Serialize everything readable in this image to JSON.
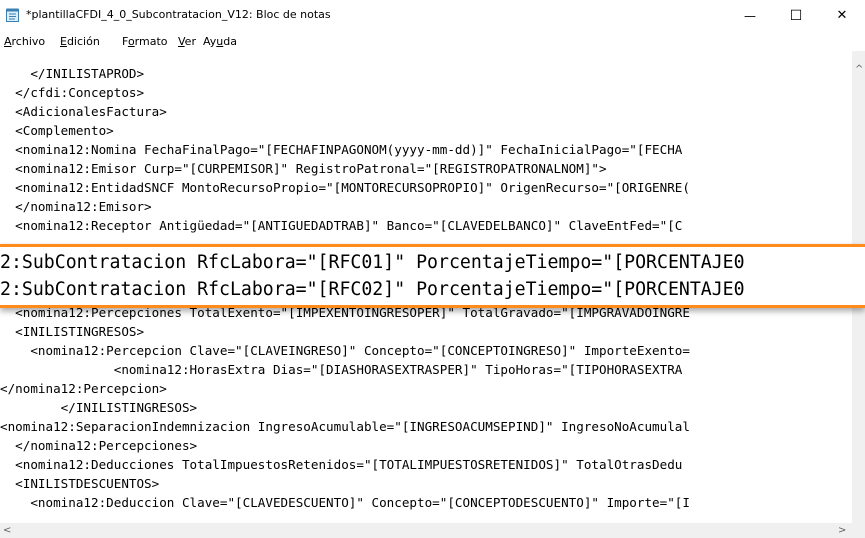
{
  "window": {
    "title": "*plantillaCFDI_4_0_Subcontratacion_V12: Bloc de notas",
    "minimize_glyph": "—",
    "maximize_glyph": "☐",
    "close_glyph": "✕"
  },
  "menu": {
    "items": [
      {
        "pre": "",
        "key": "A",
        "post": "rchivo"
      },
      {
        "pre": "",
        "key": "E",
        "post": "dición"
      },
      {
        "pre": "F",
        "key": "o",
        "post": "rmato"
      },
      {
        "pre": "",
        "key": "V",
        "post": "er"
      },
      {
        "pre": "Ay",
        "key": "u",
        "post": "da"
      }
    ]
  },
  "editor": {
    "lines_top": [
      "    </INILISTAPROD>",
      "  </cfdi:Conceptos>",
      "  <AdicionalesFactura>",
      "  <Complemento>",
      "  <nomina12:Nomina FechaFinalPago=\"[FECHAFINPAGONOM(yyyy-mm-dd)]\" FechaInicialPago=\"[FECHA",
      "  <nomina12:Emisor Curp=\"[CURPEMISOR]\" RegistroPatronal=\"[REGISTROPATRONALNOM]\">",
      "  <nomina12:EntidadSNCF MontoRecursoPropio=\"[MONTORECURSOPROPIO]\" OrigenRecurso=\"[ORIGENRE(",
      "  </nomina12:Emisor>",
      "  <nomina12:Receptor Antigüedad=\"[ANTIGUEDADTRAB]\" Banco=\"[CLAVEDELBANCO]\" ClaveEntFed=\"[C"
    ],
    "lines_bottom": [
      "  <nomina12:Percepciones TotalExento=\"[IMPEXENTOINGRESOPER]\" TotalGravado=\"[IMPGRAVADOINGRE",
      "  <INILISTINGRESOS>",
      "    <nomina12:Percepcion Clave=\"[CLAVEINGRESO]\" Concepto=\"[CONCEPTOINGRESO]\" ImporteExento=",
      "               <nomina12:HorasExtra Dias=\"[DIASHORASEXTRASPER]\" TipoHoras=\"[TIPOHORASEXTRA",
      "</nomina12:Percepcion>",
      "        </INILISTINGRESOS>",
      "<nomina12:SeparacionIndemnizacion IngresoAcumulable=\"[INGRESOACUMSEPIND]\" IngresoNoAcumulal",
      "  </nomina12:Percepciones>",
      "  <nomina12:Deducciones TotalImpuestosRetenidos=\"[TOTALIMPUESTOSRETENIDOS]\" TotalOtrasDedu",
      "  <INILISTDESCUENTOS>",
      "    <nomina12:Deduccion Clave=\"[CLAVEDESCUENTO]\" Concepto=\"[CONCEPTODESCUENTO]\" Importe=\"[I"
    ]
  },
  "zoom": {
    "lines": [
      "2:SubContratacion RfcLabora=\"[RFC01]\" PorcentajeTiempo=\"[PORCENTAJE0",
      "2:SubContratacion RfcLabora=\"[RFC02]\" PorcentajeTiempo=\"[PORCENTAJE0"
    ],
    "accent_color": "#ff8c1a"
  },
  "scrollbar": {
    "up_glyph": "^",
    "left_glyph": "<",
    "right_glyph": ">"
  }
}
